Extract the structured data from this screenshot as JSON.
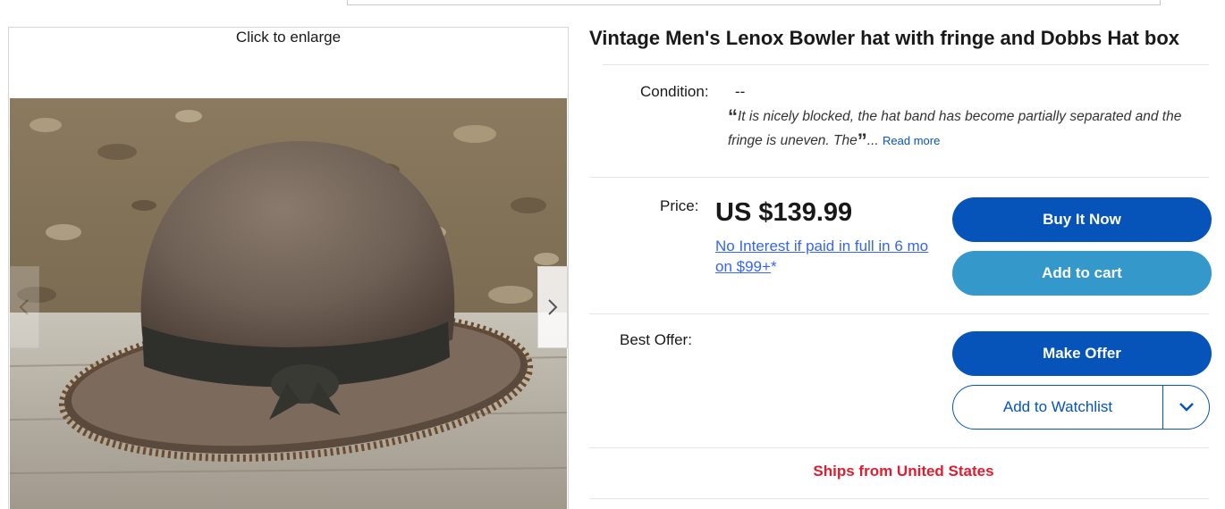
{
  "gallery": {
    "enlarge_hint": "Click to enlarge",
    "image_alt": "Brown felt bowler hat with fringed brim on a wooden rail"
  },
  "listing": {
    "title": "Vintage Men's Lenox Bowler hat with fringe and Dobbs Hat box",
    "condition_label": "Condition:",
    "condition_value": "--",
    "condition_quote": "It is nicely blocked, the hat band has become partially separated and the fringe is uneven. The",
    "ellipsis": "...",
    "read_more": "Read more",
    "price_label": "Price:",
    "price_value": "US $139.99",
    "financing_text": "No Interest if paid in full in 6 mo on $99+",
    "financing_suffix": "*",
    "best_offer_label": "Best Offer:",
    "ships_from": "Ships from United States"
  },
  "actions": {
    "buy_now": "Buy It Now",
    "add_to_cart": "Add to cart",
    "make_offer": "Make Offer",
    "add_to_watchlist": "Add to Watchlist"
  },
  "icons": {
    "prev": "chevron-left-icon",
    "next": "chevron-right-icon",
    "watch_dropdown": "chevron-down-icon"
  },
  "colors": {
    "primary_blue": "#0654ba",
    "secondary_blue": "#3498ca",
    "link_blue": "#3665f3",
    "ships_red": "#dd1e31"
  }
}
